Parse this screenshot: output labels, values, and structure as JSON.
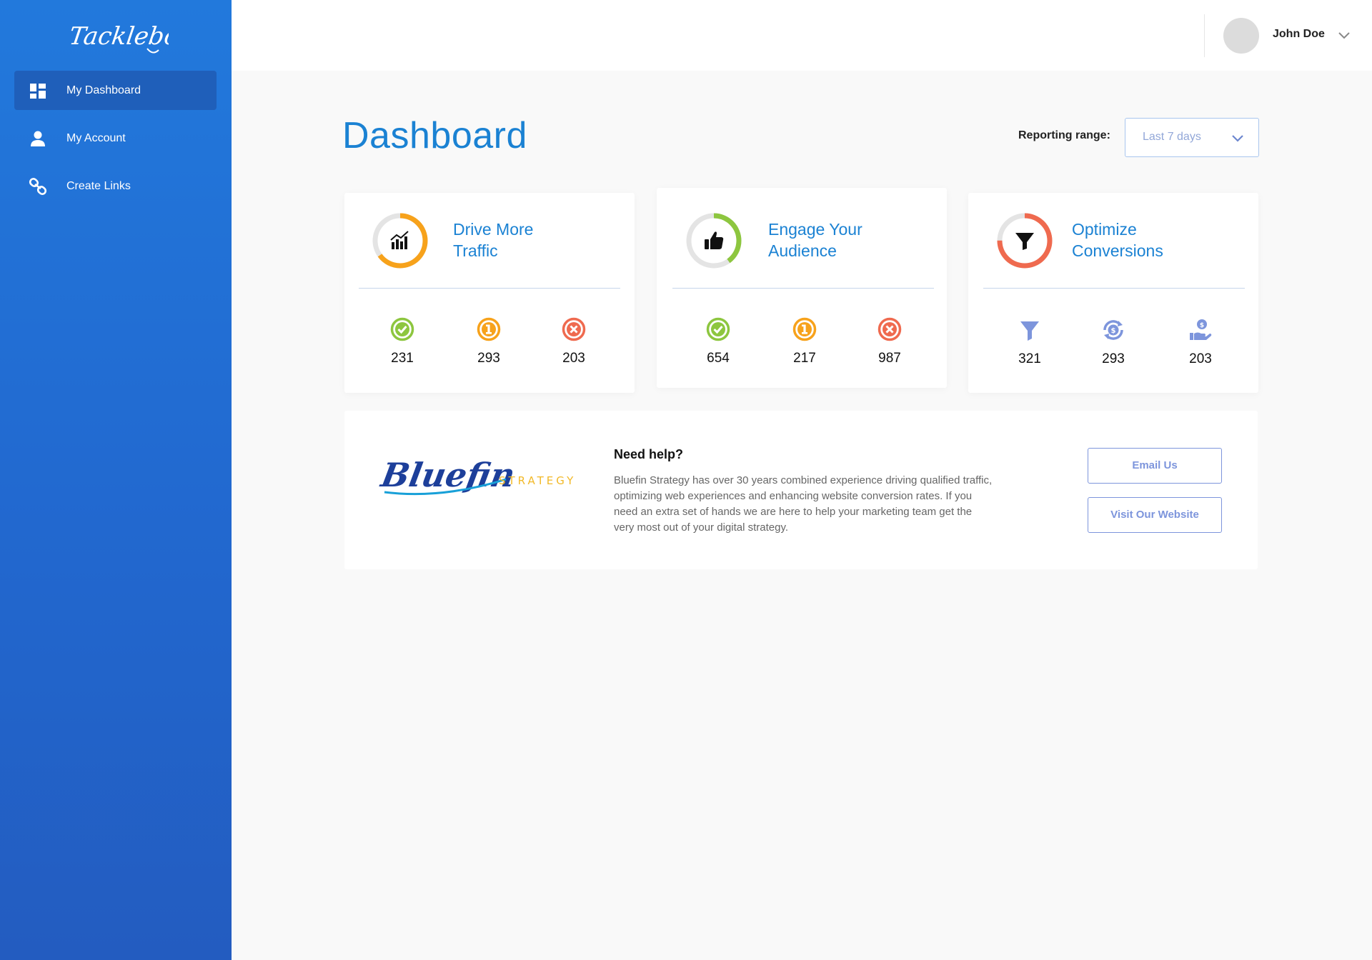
{
  "colors": {
    "sidebar": "#2272d8",
    "accent": "#1b82d3",
    "green": "#8dc63f",
    "orange": "#f7a21b",
    "red": "#ef6a4f",
    "purple": "#7d95dc"
  },
  "sidebar": {
    "logo_text": "Tacklebox",
    "items": [
      {
        "label": "My Dashboard",
        "icon": "dashboard-icon",
        "active": true
      },
      {
        "label": "My Account",
        "icon": "user-icon",
        "active": false
      },
      {
        "label": "Create Links",
        "icon": "link-icon",
        "active": false
      }
    ]
  },
  "header": {
    "user_name": "John Doe"
  },
  "main": {
    "title": "Dashboard",
    "range_label": "Reporting range:",
    "range_value": "Last 7 days",
    "cards": [
      {
        "title_line1": "Drive More",
        "title_line2": "Traffic",
        "icon": "chart-icon",
        "ring_color": "#f7a21b",
        "ring_fill": 0.65,
        "stats": [
          {
            "icon": "check-circle-icon",
            "value": "231"
          },
          {
            "icon": "alert-circle-icon",
            "value": "293"
          },
          {
            "icon": "x-circle-icon",
            "value": "203"
          }
        ]
      },
      {
        "title_line1": "Engage Your",
        "title_line2": "Audience",
        "icon": "thumbs-up-icon",
        "ring_color": "#8dc63f",
        "ring_fill": 0.4,
        "stats": [
          {
            "icon": "check-circle-icon",
            "value": "654"
          },
          {
            "icon": "alert-circle-icon",
            "value": "217"
          },
          {
            "icon": "x-circle-icon",
            "value": "987"
          }
        ]
      },
      {
        "title_line1": "Optimize",
        "title_line2": "Conversions",
        "icon": "funnel-icon",
        "ring_color": "#ef6a4f",
        "ring_fill": 0.75,
        "stats": [
          {
            "icon": "funnel-icon",
            "value": "321"
          },
          {
            "icon": "dollar-cycle-icon",
            "value": "293"
          },
          {
            "icon": "hand-dollar-icon",
            "value": "203"
          }
        ]
      }
    ]
  },
  "help": {
    "logo_text": "Bluefin",
    "logo_subtext": "STRATEGY",
    "title": "Need help?",
    "text": "Bluefin Strategy has over 30 years combined experience driving qualified traffic, optimizing web experiences and enhancing website conversion rates. If you need an extra set of hands we are here to help your marketing team get the very most out of your digital strategy.",
    "email_button": "Email Us",
    "website_button": "Visit Our Website"
  }
}
